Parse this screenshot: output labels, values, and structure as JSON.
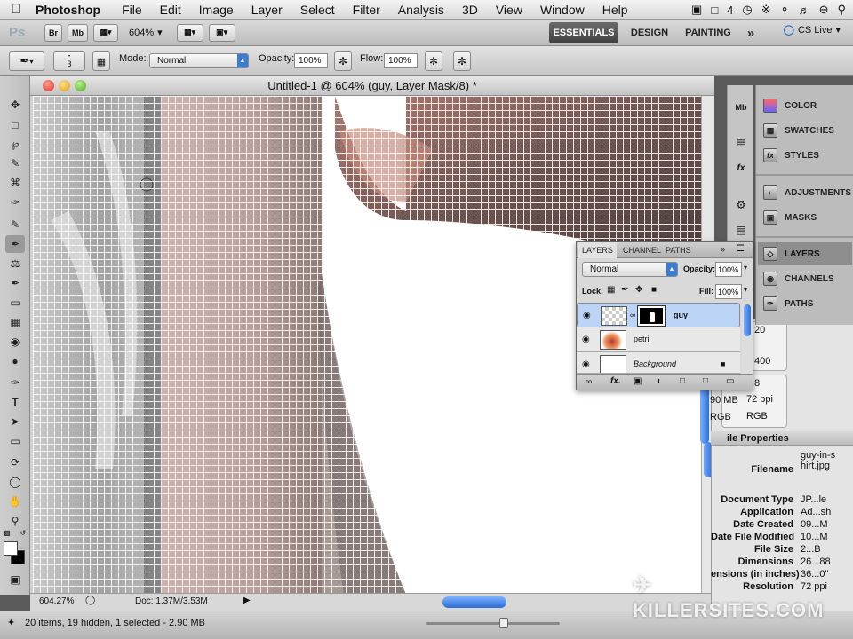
{
  "menubar": {
    "app": "Photoshop",
    "items": [
      "File",
      "Edit",
      "Image",
      "Layer",
      "Select",
      "Filter",
      "Analysis",
      "3D",
      "View",
      "Window",
      "Help"
    ],
    "status_badge": "4"
  },
  "appbar": {
    "logo": "Ps",
    "bridge": "Br",
    "minibridge": "Mb",
    "zoom": "604%",
    "workspaces": [
      "ESSENTIALS",
      "DESIGN",
      "PAINTING"
    ],
    "more": "»",
    "cslive": "CS Live"
  },
  "options": {
    "brush_size": "3",
    "mode_label": "Mode:",
    "mode_value": "Normal",
    "opacity_label": "Opacity:",
    "opacity_value": "100%",
    "flow_label": "Flow:",
    "flow_value": "100%"
  },
  "document": {
    "title": "Untitled-1 @ 604% (guy, Layer Mask/8) *",
    "zoom_readout": "604.27%",
    "doc_size": "Doc: 1.37M/3.53M"
  },
  "bottom_status": "20 items, 19 hidden, 1 selected - 2.90 MB",
  "dock": {
    "items": [
      "COLOR",
      "SWATCHES",
      "STYLES",
      "ADJUSTMENTS",
      "MASKS",
      "LAYERS",
      "CHANNELS",
      "PATHS"
    ]
  },
  "layers_panel": {
    "tabs": [
      "LAYERS",
      "CHANNEL",
      "PATHS"
    ],
    "blend_mode": "Normal",
    "opacity_label": "Opacity:",
    "opacity_value": "100%",
    "lock_label": "Lock:",
    "fill_label": "Fill:",
    "fill_value": "100%",
    "layers": [
      {
        "name": "guy",
        "selected": true
      },
      {
        "name": "petri",
        "selected": false
      },
      {
        "name": "Background",
        "selected": false
      }
    ]
  },
  "behind_panel": {
    "info_top": [
      "20",
      "400"
    ],
    "info_mid": [
      "8",
      "90 MB",
      "72 ppi",
      "RGB",
      "RGB"
    ],
    "file_properties_title": "ile Properties",
    "rows": [
      {
        "k": "Filename",
        "v": "guy-in-shirt.jpg"
      },
      {
        "k": "Document Type",
        "v": "JP...le"
      },
      {
        "k": "Application",
        "v": "Ad...sh"
      },
      {
        "k": "Date Created",
        "v": "09...M"
      },
      {
        "k": "Date File Modified",
        "v": "10...M"
      },
      {
        "k": "File Size",
        "v": "2...B"
      },
      {
        "k": "Dimensions",
        "v": "26...88"
      },
      {
        "k": "ensions (in inches)",
        "v": "36...0\""
      },
      {
        "k": "Resolution",
        "v": "72 ppi"
      }
    ]
  },
  "watermark": "KILLERSITES.COM",
  "colors": {
    "accent_blue": "#3a7bd5",
    "selected_row": "#bcd4f6",
    "workspace_active": "#4a4a4a"
  }
}
